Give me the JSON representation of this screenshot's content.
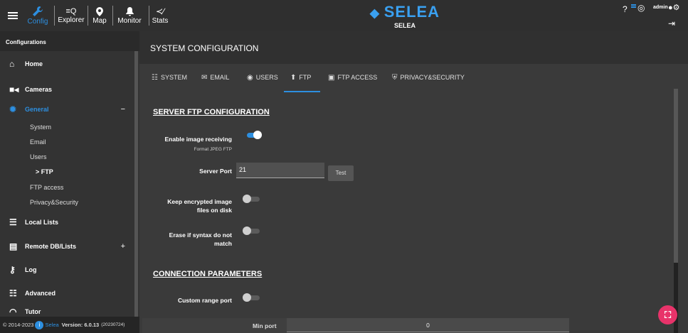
{
  "topbar": {
    "nav": [
      {
        "label": "Config",
        "icon": "wrench-icon",
        "active": true
      },
      {
        "label": "Explorer",
        "icon": "explorer-icon"
      },
      {
        "label": "Map",
        "icon": "map-pin-icon"
      },
      {
        "label": "Monitor",
        "icon": "bell-icon"
      },
      {
        "label": "Stats",
        "icon": "stats-icon"
      }
    ],
    "brand": "SELEA",
    "brand_sub": "SELEA",
    "user": "admin",
    "accent": "#3aa0f0"
  },
  "sidebar": {
    "heading": "Configurations",
    "items": [
      {
        "label": "Home",
        "icon": "home-icon"
      },
      {
        "label": "Cameras",
        "icon": "camera-icon"
      },
      {
        "label": "General",
        "icon": "gear-icon",
        "expander": "−"
      },
      {
        "label": "Local Lists",
        "icon": "list-icon"
      },
      {
        "label": "Remote DB/Lists",
        "icon": "database-icon",
        "expander": "+"
      },
      {
        "label": "Log",
        "icon": "key-icon"
      },
      {
        "label": "Advanced",
        "icon": "sliders-icon"
      },
      {
        "label": "Tutor",
        "icon": "wifi-icon"
      }
    ],
    "sub_items": [
      "System",
      "Email",
      "Users",
      "> FTP",
      "FTP access",
      "Privacy&Security"
    ],
    "footer": {
      "copyright": "© 2014-2023",
      "brand": "Selea",
      "version": "Version: 6.0.13",
      "build": "(20230724)"
    }
  },
  "main": {
    "title": "SYSTEM CONFIGURATION",
    "tabs": [
      {
        "label": "SYSTEM",
        "icon": "sliders-icon"
      },
      {
        "label": "EMAIL",
        "icon": "email-icon"
      },
      {
        "label": "USERS",
        "icon": "users-icon"
      },
      {
        "label": "FTP",
        "icon": "upload-icon",
        "active": true
      },
      {
        "label": "FTP ACCESS",
        "icon": "ftp-access-icon"
      },
      {
        "label": "PRIVACY&SECURITY",
        "icon": "shield-icon"
      }
    ],
    "server_section": "SERVER FTP CONFIGURATION",
    "enable_label": "Enable image receiving",
    "enable_sub": "Format JPEG FTP",
    "enable_on": true,
    "port_label": "Server Port",
    "port_value": "21",
    "test_label": "Test",
    "encrypted_label_1": "Keep encrypted image",
    "encrypted_label_2": "files on disk",
    "encrypted_on": false,
    "erase_label_1": "Erase if syntax do not",
    "erase_label_2": "match",
    "erase_on": false,
    "conn_section": "CONNECTION PARAMETERS",
    "custom_range_label": "Custom range port",
    "custom_range_on": false,
    "min_port_label": "Min port",
    "min_port_value": "0"
  }
}
